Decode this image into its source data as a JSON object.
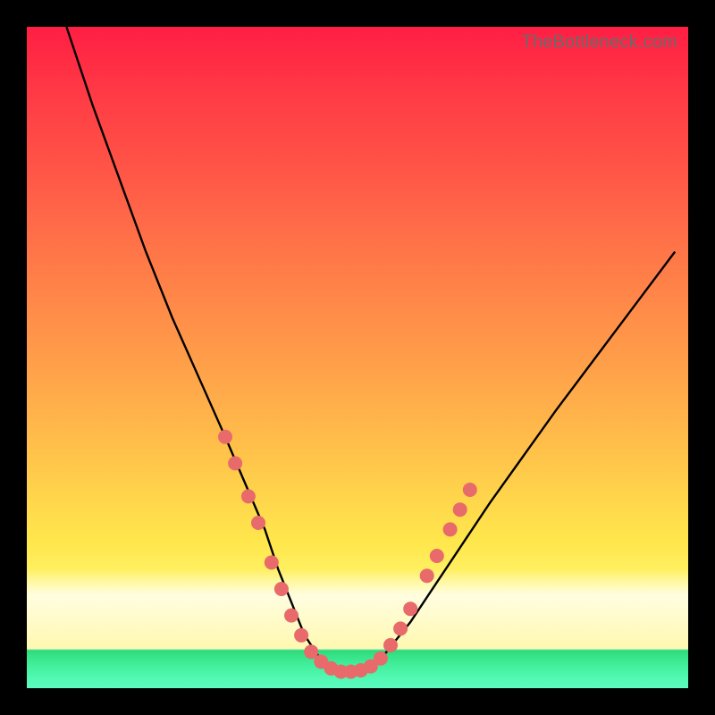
{
  "watermark": "TheBottleneck.com",
  "chart_data": {
    "type": "line",
    "title": "",
    "xlabel": "",
    "ylabel": "",
    "xlim": [
      0,
      100
    ],
    "ylim": [
      0,
      100
    ],
    "grid": false,
    "series": [
      {
        "name": "bottleneck-curve",
        "color": "#000000",
        "x": [
          6,
          10,
          14,
          18,
          22,
          26,
          30,
          33,
          36,
          38,
          40,
          42,
          44,
          46,
          48,
          50,
          52,
          54,
          58,
          62,
          66,
          70,
          75,
          80,
          86,
          92,
          98
        ],
        "values": [
          100,
          88,
          77,
          66,
          56,
          47,
          38,
          31,
          24,
          18,
          13,
          8,
          5,
          3,
          2.5,
          2.5,
          3,
          5,
          10,
          16,
          22,
          28,
          35,
          42,
          50,
          58,
          66
        ]
      }
    ],
    "markers": {
      "name": "highlight-dots",
      "color": "#e86a6a",
      "radius_px": 8,
      "points": [
        {
          "x": 30.0,
          "y": 38
        },
        {
          "x": 31.5,
          "y": 34
        },
        {
          "x": 33.5,
          "y": 29
        },
        {
          "x": 35.0,
          "y": 25
        },
        {
          "x": 37.0,
          "y": 19
        },
        {
          "x": 38.5,
          "y": 15
        },
        {
          "x": 40.0,
          "y": 11
        },
        {
          "x": 41.5,
          "y": 8
        },
        {
          "x": 43.0,
          "y": 5.5
        },
        {
          "x": 44.5,
          "y": 4
        },
        {
          "x": 46.0,
          "y": 3
        },
        {
          "x": 47.5,
          "y": 2.5
        },
        {
          "x": 49.0,
          "y": 2.5
        },
        {
          "x": 50.5,
          "y": 2.7
        },
        {
          "x": 52.0,
          "y": 3.3
        },
        {
          "x": 53.5,
          "y": 4.5
        },
        {
          "x": 55.0,
          "y": 6.5
        },
        {
          "x": 56.5,
          "y": 9
        },
        {
          "x": 58.0,
          "y": 12
        },
        {
          "x": 60.5,
          "y": 17
        },
        {
          "x": 62.0,
          "y": 20
        },
        {
          "x": 64.0,
          "y": 24
        },
        {
          "x": 65.5,
          "y": 27
        },
        {
          "x": 67.0,
          "y": 30
        }
      ]
    },
    "background_gradient": {
      "stops": [
        {
          "pos": 0.0,
          "color": "#ff1e44"
        },
        {
          "pos": 0.5,
          "color": "#ffb64a"
        },
        {
          "pos": 0.8,
          "color": "#fff36a"
        },
        {
          "pos": 0.94,
          "color": "#fffcd0"
        },
        {
          "pos": 1.0,
          "color": "#5cfcc0"
        }
      ]
    }
  }
}
